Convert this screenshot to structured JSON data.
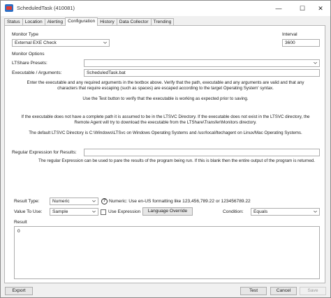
{
  "window": {
    "title": "ScheduledTask (410081)"
  },
  "tabs": [
    "Status",
    "Location",
    "Alerting",
    "Configuration",
    "History",
    "Data Collector",
    "Trending"
  ],
  "active_tab": "Configuration",
  "monitor_type": {
    "label": "Monitor Type",
    "value": "External EXE Check"
  },
  "interval": {
    "label": "Interval",
    "value": "3600"
  },
  "monitor_options": {
    "label": "Monitor Options",
    "ltshare_presets_label": "LTShare Presets:",
    "ltshare_presets_value": "",
    "executable_label": "Executable / Arguments:",
    "executable_value": "ScheduledTask.bat"
  },
  "notes": {
    "enter_1": "Enter the executable and any required arguments in the textbox above. Verify that the path, executable and any arguments are valid and that any",
    "enter_2": "characters that require escaping (such as spaces) are escaped according to the target Operating System' syntax.",
    "test_button": "Use the Test button to verify that the executable is working as expected prior to saving.",
    "path_1": "If the executable does not have a complete path it is assumed to be in the LTSVC Directory. If the executable does not exist in the LTSVC directory, the",
    "path_2": "Remote Agent will try to download the executable from the LTShare\\Transfer\\Monitors directory.",
    "default_dir": "The default LTSVC Directory is C:\\Windows\\LTSvc on Windows Operating Systems and /usr/local/ltechagent on Linux/Mac Operating Systems.",
    "regex": "The regular Expression can be used to pare the results of the program being run. If this is blank then the entire output of the program is returned."
  },
  "regex": {
    "label": "Regular Expression for Results:",
    "value": ""
  },
  "result_type": {
    "label": "Result Type:",
    "value": "Numeric",
    "help": "?",
    "hint": "Numeric: Use en-US formatting like 123,456,789.22 or 123456789.22"
  },
  "value_to_use": {
    "label": "Value To Use:",
    "value": "Sample"
  },
  "use_expression": {
    "label": "Use Expression",
    "checked": false
  },
  "language_override": {
    "label": "Language Override"
  },
  "condition": {
    "label": "Condition:",
    "value": "Equals"
  },
  "result": {
    "label": "Result",
    "value": "0"
  },
  "footer": {
    "export": "Export",
    "test": "Test",
    "cancel": "Cancel",
    "save": "Save"
  },
  "window_controls": {
    "minimize": "—",
    "maximize": "☐",
    "close": "✕"
  }
}
